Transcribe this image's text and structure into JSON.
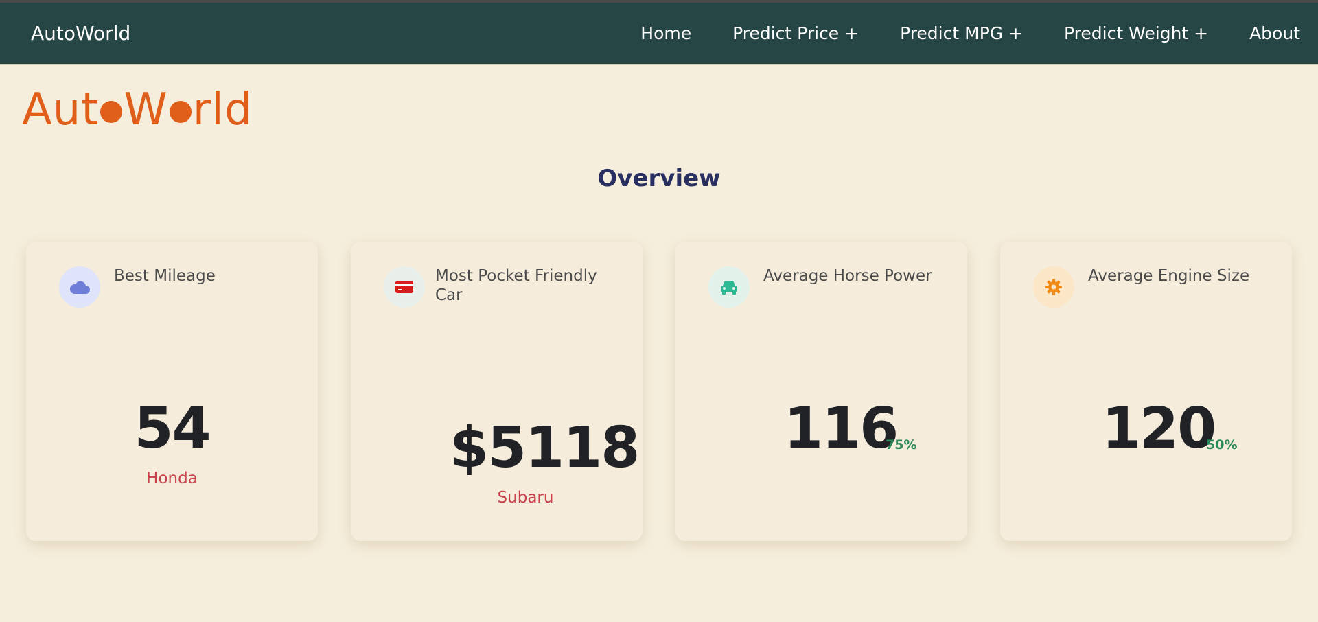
{
  "nav": {
    "brand": "AutoWorld",
    "links": [
      "Home",
      "Predict Price +",
      "Predict MPG +",
      "Predict Weight +",
      "About"
    ]
  },
  "logo": {
    "part1": "Aut",
    "part2": "W",
    "part3": "rld"
  },
  "overview": {
    "title": "Overview"
  },
  "cards": [
    {
      "title": "Best Mileage",
      "value": "54",
      "sub": "Honda",
      "icon": "cloud-icon",
      "icon_bg": "#dfe4fb",
      "icon_color": "#6f7fd8"
    },
    {
      "title": "Most Pocket Friendly Car",
      "value": "$5118",
      "sub": "Subaru",
      "icon": "credit-card-icon",
      "icon_bg": "#e8efea",
      "icon_color": "#d81c1c"
    },
    {
      "title": "Average Horse Power",
      "value": "116",
      "pct": "75%",
      "icon": "car-icon",
      "icon_bg": "#e2f1ea",
      "icon_color": "#2fb894"
    },
    {
      "title": "Average Engine Size",
      "value": "120",
      "pct": "50%",
      "icon": "gear-icon",
      "icon_bg": "#fce6c8",
      "icon_color": "#ef8b18"
    }
  ]
}
